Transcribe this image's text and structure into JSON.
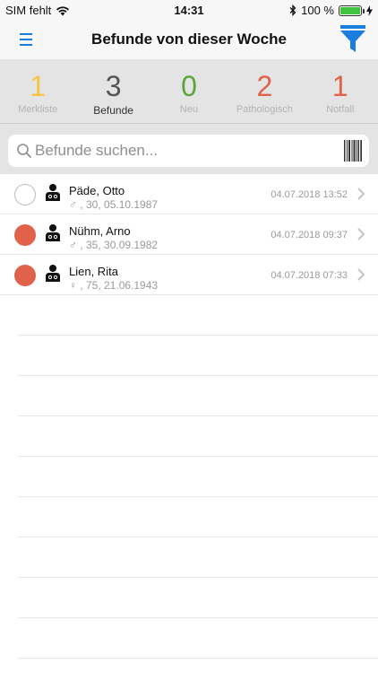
{
  "status_bar": {
    "carrier": "SIM fehlt",
    "time": "14:31",
    "battery_percent": "100 %",
    "battery_level": 1.0
  },
  "nav": {
    "title": "Befunde von dieser Woche",
    "menu_icon": "hamburger-icon",
    "filter_icon": "funnel-icon"
  },
  "stats": [
    {
      "value": "1",
      "label": "Merkliste",
      "color": "#f5c542",
      "active": false
    },
    {
      "value": "3",
      "label": "Befunde",
      "color": "#555555",
      "active": true
    },
    {
      "value": "0",
      "label": "Neu",
      "color": "#5aa63a",
      "active": false
    },
    {
      "value": "2",
      "label": "Pathologisch",
      "color": "#e0624a",
      "active": false
    },
    {
      "value": "1",
      "label": "Notfall",
      "color": "#e0624a",
      "active": false
    }
  ],
  "search": {
    "placeholder": "Befunde suchen...",
    "value": ""
  },
  "results": [
    {
      "name": "Päde, Otto",
      "info": "♂  , 30, 05.10.1987",
      "date": "04.07.2018 13:52",
      "marker": "empty"
    },
    {
      "name": "Nühm, Arno",
      "info": "♂  , 35, 30.09.1982",
      "date": "04.07.2018 09:37",
      "marker": "filled"
    },
    {
      "name": "Lien, Rita",
      "info": "♀  , 75, 21.06.1943",
      "date": "04.07.2018 07:33",
      "marker": "filled"
    }
  ],
  "colors": {
    "accent": "#1a7ee0",
    "pathologic": "#e0624a"
  }
}
